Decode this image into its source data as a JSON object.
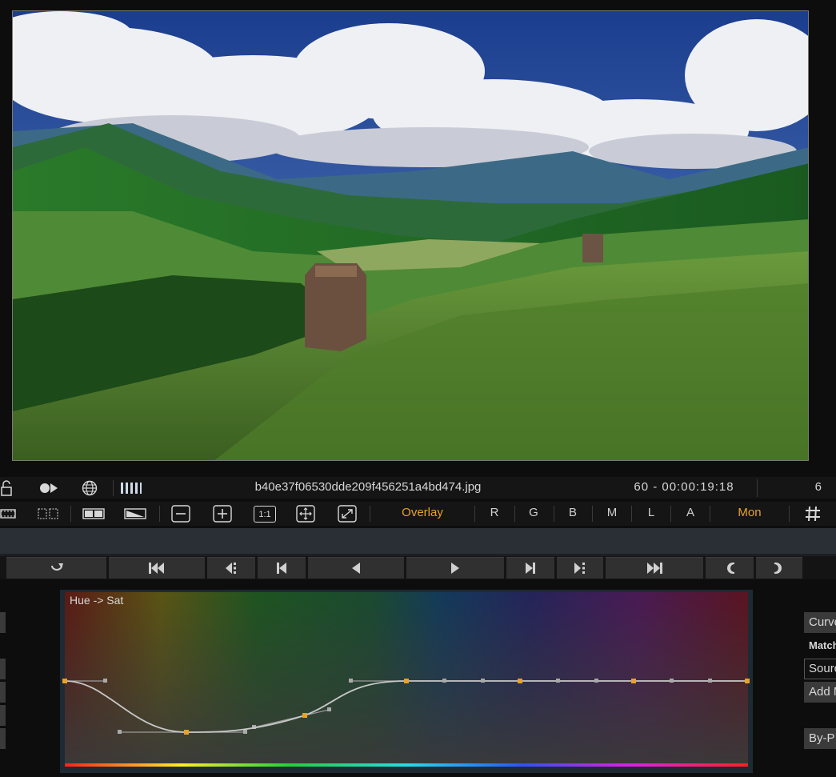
{
  "viewer": {
    "image_icon": "mountain-landscape-image"
  },
  "infobar": {
    "filename": "b40e37f06530dde209f456251a4bd474.jpg",
    "frame_timecode": "60  -  00:00:19:18",
    "frame_count": "6",
    "icons": [
      "lock-open-icon",
      "record-toggle-icon",
      "globe-icon",
      "bars-icon"
    ]
  },
  "toolbar": {
    "overlay_label": "Overlay",
    "channels": [
      "R",
      "G",
      "B",
      "M",
      "L",
      "A"
    ],
    "mon_label": "Mon",
    "one_to_one_label": "1:1"
  },
  "transport": {
    "icons": [
      "loop-icon",
      "go-to-start-icon",
      "prev-key-icon",
      "prev-frame-icon",
      "play-backward-icon",
      "play-forward-icon",
      "next-frame-icon",
      "next-key-icon",
      "go-to-end-icon",
      "mark-in-icon",
      "mark-out-icon"
    ]
  },
  "curve": {
    "title": "Hue -> Sat",
    "accent": "#e8a227"
  },
  "right_panel": {
    "curve_button": "Curve",
    "match_label": "Match",
    "source_field": "Source",
    "add_button": "Add M",
    "by_button": "By-P"
  },
  "colors": {
    "accent": "#e8a227",
    "panel_bg": "#141414"
  }
}
